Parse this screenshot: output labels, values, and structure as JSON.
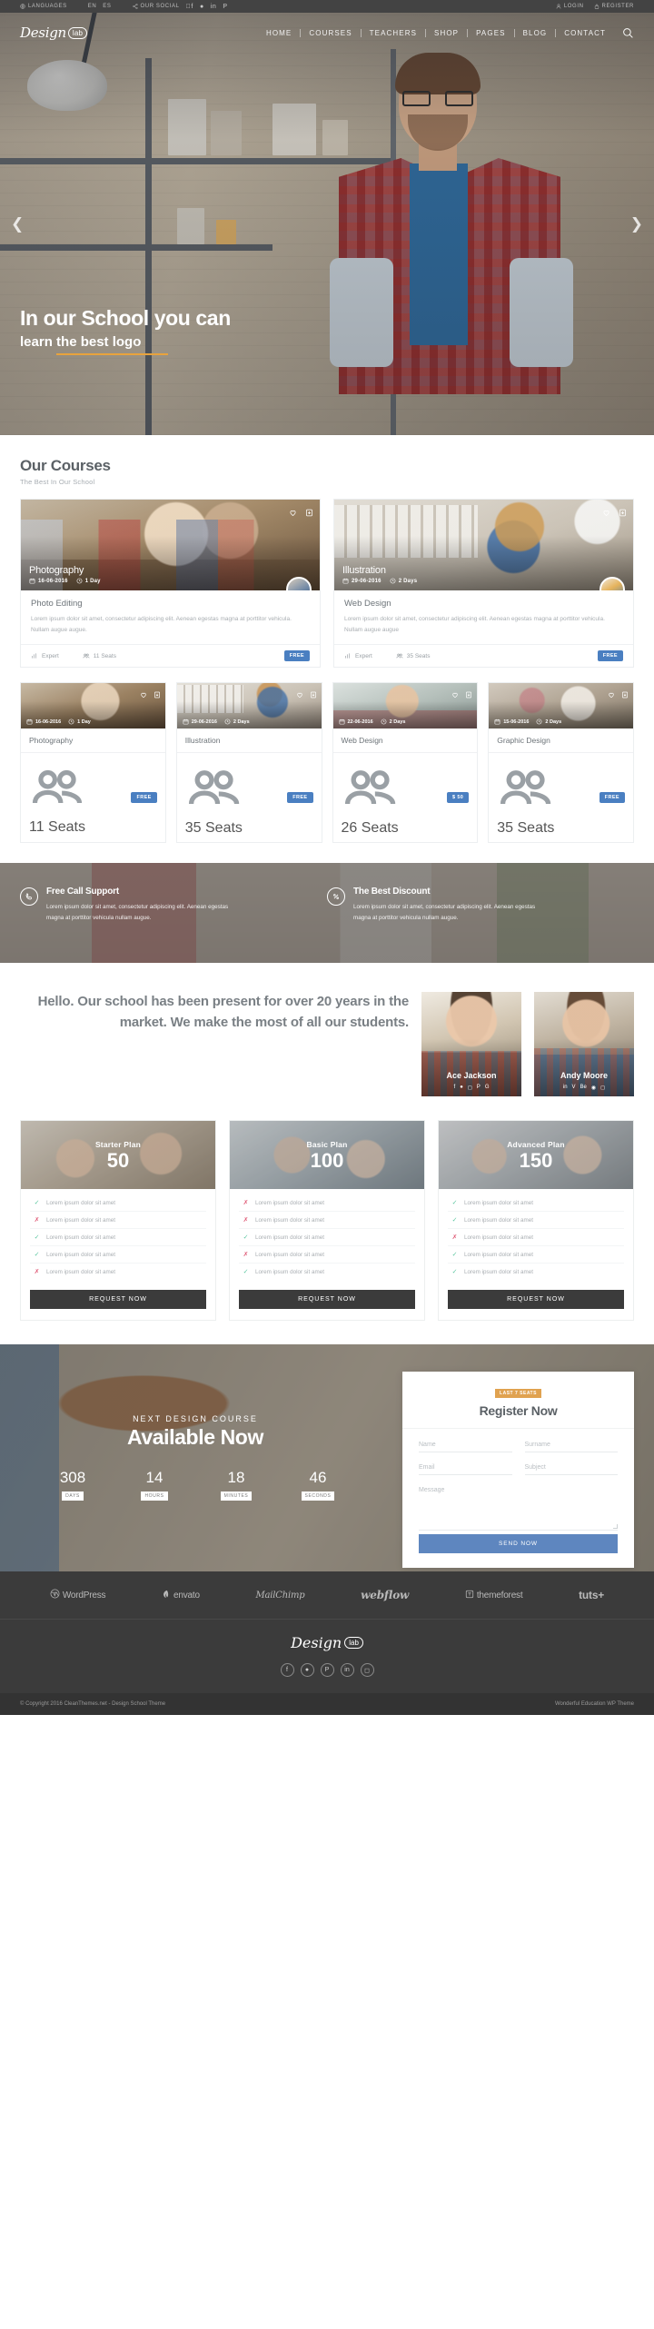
{
  "topbar": {
    "languages_icon": "globe-icon",
    "languages_label": "LANGUAGES",
    "lang_en": "EN",
    "lang_es": "ES",
    "social_icon": "share-icon",
    "social_label": "OUR SOCIAL",
    "socials": [
      "facebook-icon",
      "twitter-icon",
      "linkedin-icon",
      "pinterest-icon"
    ],
    "login_icon": "user-icon",
    "login_label": "LOGIN",
    "register_icon": "lock-icon",
    "register_label": "REGISTER"
  },
  "brand": {
    "name": "Design",
    "badge": "lab"
  },
  "nav": {
    "items": [
      "HOME",
      "COURSES",
      "TEACHERS",
      "SHOP",
      "PAGES",
      "BLOG",
      "CONTACT"
    ],
    "search_icon": "search-icon"
  },
  "hero": {
    "prev_icon": "chevron-left-icon",
    "next_icon": "chevron-right-icon",
    "title": "In our School you can",
    "subtitle_pre": "learn ",
    "subtitle_highlight": " the best logo",
    "underline_color": "#e8a33d"
  },
  "courses": {
    "title": "Our Courses",
    "subtitle": "The Best In Our School",
    "featured": [
      {
        "category": "Photography",
        "date": "16-06-2016",
        "duration": "1 Day",
        "name": "Photo Editing",
        "description": "Lorem ipsum dolor sit amet, consectetur adipiscing elit. Aenean egestas magna at porttitor vehicula. Nullam augue augue.",
        "level": "Expert",
        "seats": "11 Seats",
        "price": "FREE",
        "favorite_icon": "heart-icon",
        "bookmark_icon": "bookmark-icon",
        "date_icon": "calendar-icon",
        "duration_icon": "clock-icon",
        "level_icon": "bars-icon",
        "seats_icon": "users-icon"
      },
      {
        "category": "Illustration",
        "date": "29-06-2016",
        "duration": "2 Days",
        "name": "Web Design",
        "description": "Lorem ipsum dolor sit amet, consectetur adipiscing elit. Aenean egestas magna at porttitor vehicula. Nullam augue augue",
        "level": "Expert",
        "seats": "35 Seats",
        "price": "FREE",
        "favorite_icon": "heart-icon",
        "bookmark_icon": "bookmark-icon",
        "date_icon": "calendar-icon",
        "duration_icon": "clock-icon",
        "level_icon": "bars-icon",
        "seats_icon": "users-icon"
      }
    ],
    "mini": [
      {
        "date": "16-06-2016",
        "duration": "1 Day",
        "name": "Photography",
        "seats": "11 Seats",
        "price": "FREE"
      },
      {
        "date": "29-06-2016",
        "duration": "2 Days",
        "name": "Illustration",
        "seats": "35 Seats",
        "price": "FREE"
      },
      {
        "date": "22-06-2016",
        "duration": "2 Days",
        "name": "Web Design",
        "seats": "26 Seats",
        "price": "$ 50"
      },
      {
        "date": "15-06-2016",
        "duration": "2 Days",
        "name": "Graphic Design",
        "seats": "35 Seats",
        "price": "FREE"
      }
    ]
  },
  "features": [
    {
      "icon": "phone-circle-icon",
      "title": "Free Call Support",
      "text": "Lorem ipsum dolor sit amet, consectetur adipiscing elit. Aenean egestas magna at porttitor vehicula nullam augue."
    },
    {
      "icon": "percent-circle-icon",
      "title": "The Best Discount",
      "text": "Lorem ipsum dolor sit amet, consectetur adipiscing elit. Aenean egestas magna at porttitor vehicula nullam augue."
    }
  ],
  "about": {
    "heading": "Hello. Our school has been present for over 20 years in the market. We make the most of all our students.",
    "teachers": [
      {
        "name": "Ace Jackson",
        "socials": [
          "facebook-icon",
          "twitter-icon",
          "instagram-icon",
          "pinterest-icon",
          "googleplus-icon"
        ]
      },
      {
        "name": "Andy Moore",
        "socials": [
          "linkedin-icon",
          "vimeo-icon",
          "behance-icon",
          "dribbble-icon",
          "instagram-icon"
        ]
      }
    ]
  },
  "pricing": {
    "button_label": "REQUEST NOW",
    "feature_text": "Lorem ipsum dolor sit amet",
    "plans": [
      {
        "name": "Starter Plan",
        "price": "50",
        "features": [
          true,
          false,
          true,
          true,
          false
        ]
      },
      {
        "name": "Basic Plan",
        "price": "100",
        "features": [
          false,
          false,
          true,
          false,
          true
        ]
      },
      {
        "name": "Advanced Plan",
        "price": "150",
        "features": [
          true,
          true,
          false,
          true,
          true
        ]
      }
    ]
  },
  "cta": {
    "kicker": "NEXT DESIGN COURSE",
    "title": "Available Now",
    "counters": [
      {
        "value": "308",
        "label": "DAYS"
      },
      {
        "value": "14",
        "label": "HOURS"
      },
      {
        "value": "18",
        "label": "MINUTES"
      },
      {
        "value": "46",
        "label": "SECONDS"
      }
    ],
    "form": {
      "badge": "LAST 7 SEATS",
      "title": "Register Now",
      "name_placeholder": "Name",
      "surname_placeholder": "Surname",
      "email_placeholder": "Email",
      "subject_placeholder": "Subject",
      "message_placeholder": "Message",
      "submit_label": "SEND NOW"
    }
  },
  "brands": [
    {
      "icon": "wordpress-icon",
      "label": "WordPress"
    },
    {
      "icon": "envato-icon",
      "label": "envato"
    },
    {
      "icon": "",
      "label": "MailChimp"
    },
    {
      "icon": "",
      "label": "webflow"
    },
    {
      "icon": "themeforest-icon",
      "label": "themeforest"
    },
    {
      "icon": "",
      "label": "tuts+"
    }
  ],
  "footer": {
    "socials": [
      "facebook-icon",
      "twitter-icon",
      "pinterest-icon",
      "linkedin-icon",
      "instagram-icon"
    ],
    "copyright": "© Copyright 2016 CleanThemes.net - Design School Theme",
    "tagline": "Wonderful Education WP Theme"
  }
}
